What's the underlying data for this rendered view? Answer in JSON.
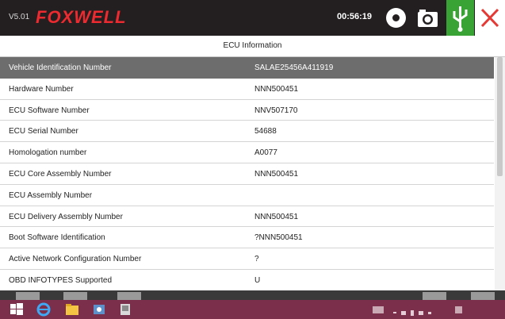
{
  "header": {
    "version": "V5.01",
    "brand": "FOXWELL",
    "time": "00:56:19"
  },
  "page": {
    "title": "ECU Information"
  },
  "rows": [
    {
      "label": "Vehicle Identification Number",
      "value": "SALAE25456A411919"
    },
    {
      "label": "Hardware Number",
      "value": "NNN500451"
    },
    {
      "label": "ECU Software Number",
      "value": "NNV507170"
    },
    {
      "label": "ECU Serial Number",
      "value": "54688"
    },
    {
      "label": "Homologation number",
      "value": "A0077"
    },
    {
      "label": "ECU Core Assembly Number",
      "value": "NNN500451"
    },
    {
      "label": "ECU Assembly Number",
      "value": ""
    },
    {
      "label": "ECU Delivery Assembly Number",
      "value": "NNN500451"
    },
    {
      "label": "Boot Software Identification",
      "value": "?NNN500451"
    },
    {
      "label": "Active Network Configuration Number",
      "value": "?"
    },
    {
      "label": "OBD INFOTYPES Supported",
      "value": "U"
    }
  ],
  "selected_row": 0,
  "icons": {
    "record": "record-icon",
    "camera": "camera-icon",
    "usb": "usb-icon",
    "close": "close-icon",
    "back": "back-icon",
    "home": "home-icon",
    "print": "print-icon",
    "upload": "upload-icon",
    "exit": "exit-icon"
  },
  "colors": {
    "topbar": "#231f20",
    "brand": "#ec2a2f",
    "usb": "#3aa335",
    "close": "#e53935",
    "selected_row": "#6d6d6d",
    "taskbar": "#7b2f4a"
  }
}
